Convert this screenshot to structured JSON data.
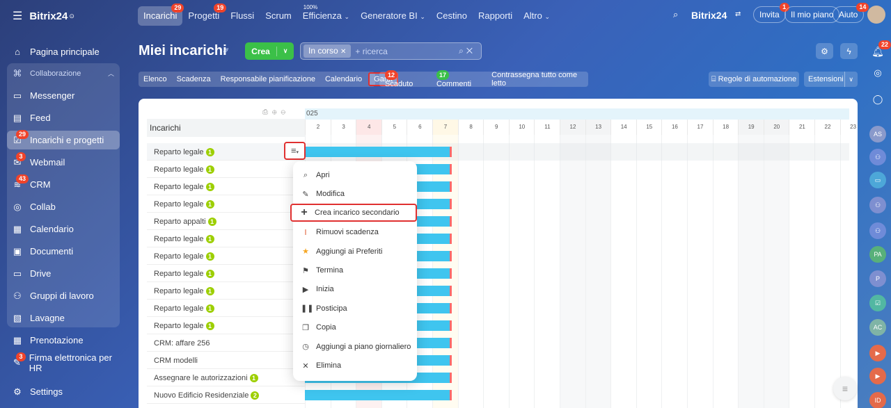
{
  "brand": "Bitrix24",
  "nav": [
    {
      "label": "Incarichi",
      "badge": "29",
      "active": true
    },
    {
      "label": "Progetti",
      "badge": "19"
    },
    {
      "label": "Flussi"
    },
    {
      "label": "Scrum"
    },
    {
      "label": "Efficienza",
      "sup": "100%"
    },
    {
      "label": "Generatore BI"
    },
    {
      "label": "Cestino"
    },
    {
      "label": "Rapporti"
    },
    {
      "label": "Altro"
    }
  ],
  "topright": {
    "brand": "Bitrix24",
    "invite": "Invita",
    "invite_badge": "1",
    "plan": "Il mio piano",
    "help": "Aiuto",
    "help_badge": "14"
  },
  "sidebar": [
    {
      "label": "Pagina principale",
      "icon": "home-icon"
    },
    {
      "label": "Collaborazione",
      "icon": "collab-icon"
    },
    {
      "label": "Messenger",
      "icon": "chat-icon"
    },
    {
      "label": "Feed",
      "icon": "feed-icon"
    },
    {
      "label": "Incarichi e progetti",
      "icon": "tasks-icon",
      "badge": "29"
    },
    {
      "label": "Webmail",
      "icon": "mail-icon",
      "badge": "3"
    },
    {
      "label": "CRM",
      "icon": "crm-icon",
      "badge": "43"
    },
    {
      "label": "Collab",
      "icon": "collab-ring-icon"
    },
    {
      "label": "Calendario",
      "icon": "calendar-icon"
    },
    {
      "label": "Documenti",
      "icon": "docs-icon"
    },
    {
      "label": "Drive",
      "icon": "drive-icon"
    },
    {
      "label": "Gruppi di lavoro",
      "icon": "groups-icon"
    },
    {
      "label": "Lavagne",
      "icon": "board-icon"
    },
    {
      "label": "Prenotazione",
      "icon": "booking-icon"
    },
    {
      "label": "Firma elettronica per HR",
      "icon": "sign-icon",
      "badge": "3"
    },
    {
      "label": "Settings",
      "icon": "gear-icon"
    }
  ],
  "header": {
    "title": "Miei incarichi",
    "create": "Crea",
    "filter_tag": "In corso",
    "search_placeholder": "+ ricerca"
  },
  "views": [
    "Elenco",
    "Scadenza",
    "Responsabile pianificazione",
    "Calendario",
    "Gantt"
  ],
  "counters": {
    "overdue_count": "12",
    "overdue_label": "Scaduto",
    "comments_count": "17",
    "comments_label": "Commenti",
    "mark_read": "Contrassegna tutto come letto"
  },
  "automation": "Regole di automazione",
  "extensions": "Estensioni",
  "table": {
    "header": "Incarichi",
    "year": "025"
  },
  "days": [
    "2",
    "3",
    "4",
    "5",
    "6",
    "7",
    "8",
    "9",
    "10",
    "11",
    "12",
    "13",
    "14",
    "15",
    "16",
    "17",
    "18",
    "19",
    "20",
    "21",
    "22",
    "23"
  ],
  "rows": [
    {
      "name": "Reparto legale",
      "count": "1"
    },
    {
      "name": "Reparto legale",
      "count": "1"
    },
    {
      "name": "Reparto legale",
      "count": "1"
    },
    {
      "name": "Reparto legale",
      "count": "1"
    },
    {
      "name": "Reparto appalti",
      "count": "1"
    },
    {
      "name": "Reparto legale",
      "count": "1"
    },
    {
      "name": "Reparto legale",
      "count": "1"
    },
    {
      "name": "Reparto legale",
      "count": "1"
    },
    {
      "name": "Reparto legale",
      "count": "1"
    },
    {
      "name": "Reparto legale",
      "count": "1"
    },
    {
      "name": "Reparto legale",
      "count": "1"
    },
    {
      "name": "CRM: affare 256",
      "count": ""
    },
    {
      "name": "CRM modelli",
      "count": ""
    },
    {
      "name": "Assegnare le autorizzazioni",
      "count": "1"
    },
    {
      "name": "Nuovo Edificio Residenziale",
      "count": "2"
    }
  ],
  "menu": [
    {
      "label": "Apri",
      "icon": "search-icon"
    },
    {
      "label": "Modifica",
      "icon": "pencil-icon"
    },
    {
      "label": "Crea incarico secondario",
      "icon": "plus-icon"
    },
    {
      "label": "Rimuovi scadenza",
      "icon": "remove-deadline-icon"
    },
    {
      "label": "Aggiungi ai Preferiti",
      "icon": "star-icon"
    },
    {
      "label": "Termina",
      "icon": "flag-icon"
    },
    {
      "label": "Inizia",
      "icon": "play-icon"
    },
    {
      "label": "Posticipa",
      "icon": "pause-icon"
    },
    {
      "label": "Copia",
      "icon": "copy-icon"
    },
    {
      "label": "Aggiungi a piano giornaliero",
      "icon": "clock-icon"
    },
    {
      "label": "Elimina",
      "icon": "close-icon"
    }
  ],
  "rightbar": [
    "AS",
    "PA",
    "P",
    "AC",
    "ID"
  ],
  "colors": {
    "accent_red": "#e03030",
    "bar": "#3fc5ef",
    "green": "#3bc048",
    "count_green": "#9dcf00"
  }
}
